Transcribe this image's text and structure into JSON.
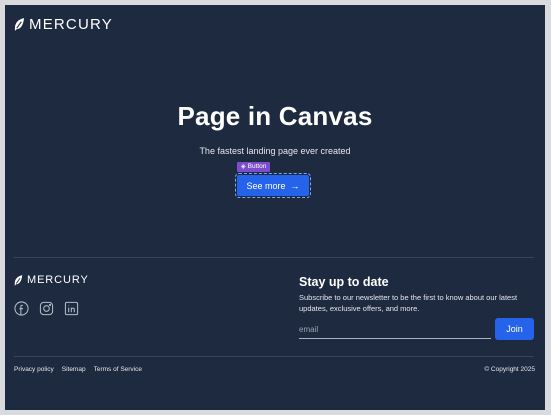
{
  "header": {
    "logo_text": "MERCURY",
    "logo_icon": "feather-icon"
  },
  "hero": {
    "title": "Page in Canvas",
    "subtitle": "The fastest landing page ever created",
    "selection_tag": "Button",
    "cta_label": "See more",
    "cta_icon": "arrow-right-icon"
  },
  "footer": {
    "logo_text": "MERCURY",
    "social_icons": [
      "facebook-icon",
      "instagram-icon",
      "linkedin-icon"
    ],
    "newsletter": {
      "title": "Stay up to date",
      "description": "Subscribe to our newsletter to be the first to know about our latest updates, exclusive offers, and more.",
      "email_placeholder": "email",
      "join_label": "Join"
    },
    "links": [
      "Privacy policy",
      "Sitemap",
      "Terms of Service"
    ],
    "copyright": "© Copyright 2025"
  },
  "colors": {
    "background": "#1e2a40",
    "accent": "#2563eb",
    "selection": "#7c4dcc",
    "outer": "#d9dadd"
  }
}
